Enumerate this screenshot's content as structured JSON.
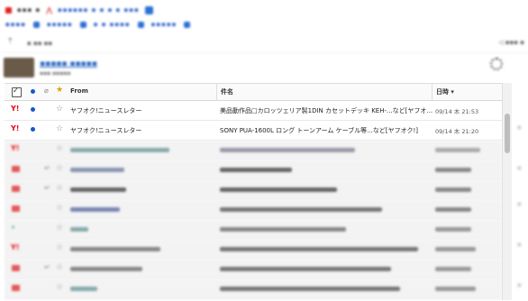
{
  "colors": {
    "accent": "#1a56c8",
    "yahoo_red": "#e60012",
    "link": "#2060c0"
  },
  "table": {
    "headers": {
      "from": "From",
      "subject": "件名",
      "date": "日時 ▾"
    },
    "rows": [
      {
        "from": "ヤフオク!ニュースレター",
        "subject": "美品動作品□カロッツェリア製1DIN カセットデッキ KEH-...など[ヤフオ...",
        "date": "09/14 木 21:53",
        "unread": true
      },
      {
        "from": "ヤフオク!ニュースレター",
        "subject": "SONY PUA-1600L ロング トーンアーム ケーブル等...など[ヤフオク!]",
        "date": "09/14 木 21:20",
        "unread": true
      }
    ]
  }
}
